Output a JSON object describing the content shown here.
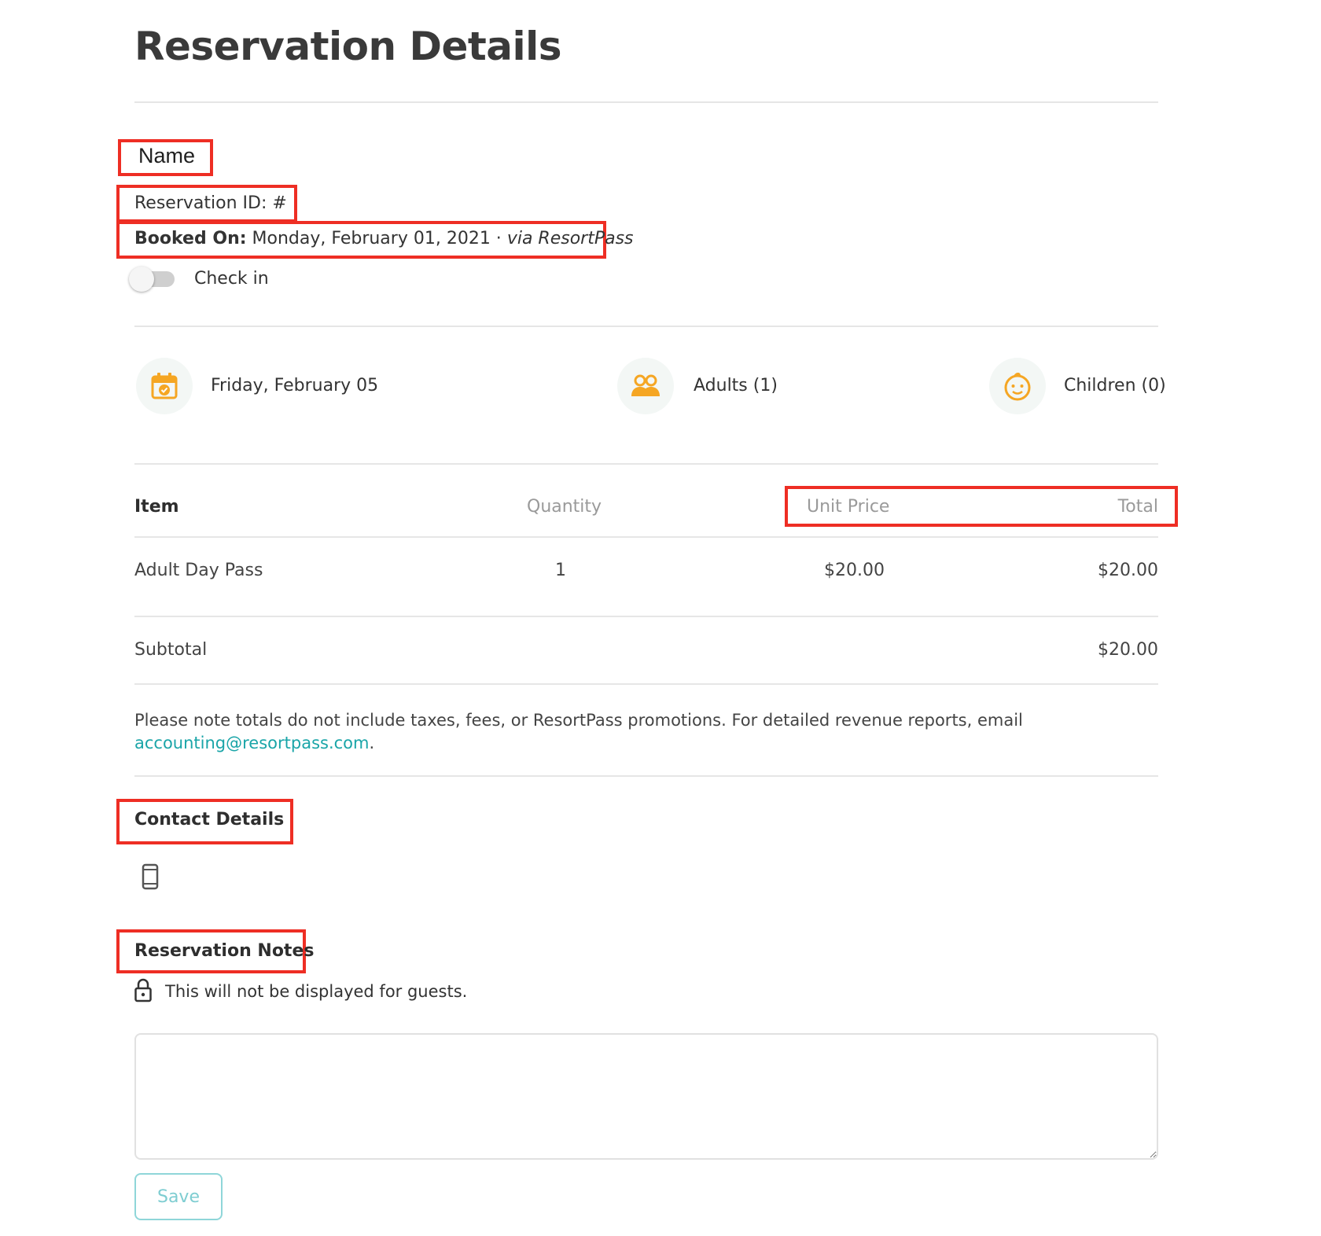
{
  "page": {
    "title": "Reservation Details"
  },
  "guest": {
    "name": "Name",
    "reservation_id_label": "Reservation ID: #",
    "booked_on_label": "Booked On:",
    "booked_on_value": "Monday, February 01, 2021 ·",
    "booked_via": "via ResortPass"
  },
  "check_in": {
    "label": "Check in",
    "checked": false
  },
  "summary": {
    "date": "Friday, February 05",
    "adults": "Adults (1)",
    "children": "Children (0)"
  },
  "table": {
    "headers": {
      "item": "Item",
      "quantity": "Quantity",
      "unit_price": "Unit Price",
      "total": "Total"
    },
    "rows": [
      {
        "item": "Adult Day Pass",
        "quantity": "1",
        "unit_price": "$20.00",
        "total": "$20.00"
      }
    ],
    "subtotal_label": "Subtotal",
    "subtotal_value": "$20.00"
  },
  "note": {
    "text": "Please note totals do not include taxes, fees, or ResortPass promotions. For detailed revenue reports, email",
    "email": "accounting@resortpass.com",
    "suffix": "."
  },
  "contact": {
    "title": "Contact Details"
  },
  "reservation_notes": {
    "title": "Reservation Notes",
    "hint": "This will not be displayed for guests.",
    "value": "",
    "save_label": "Save"
  },
  "colors": {
    "accent_teal": "#1aa5a8",
    "icon_orange": "#f5a623",
    "highlight_red": "#ee2e24"
  },
  "icons": {
    "date": "calendar-check-icon",
    "adults": "people-icon",
    "children": "child-face-icon",
    "contact": "mobile-phone-icon",
    "notes": "lock-icon"
  }
}
